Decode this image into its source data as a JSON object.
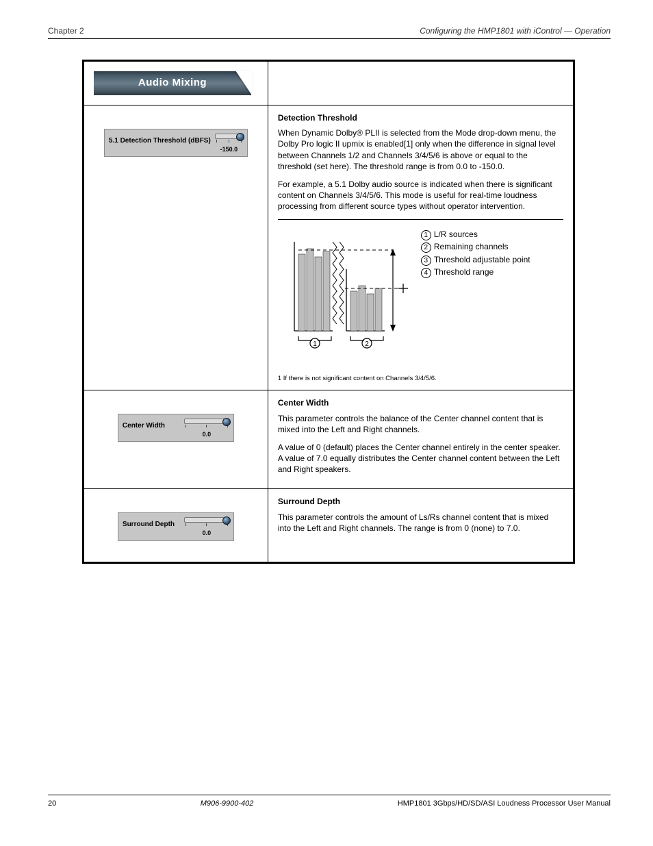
{
  "header": {
    "left": "Chapter 2",
    "right": "Configuring the HMP1801 with iControl — Operation"
  },
  "banner": {
    "title": "Audio Mixing"
  },
  "rows": [
    {
      "widget": {
        "label": "5.1 Detection Threshold (dBFS)",
        "value": "-150.0"
      },
      "desc": {
        "title": "Detection Threshold",
        "paragraphs": [
          "When Dynamic Dolby® PLII is selected from the Mode drop-down menu, the Dolby Pro logic II upmix is enabled[1] only when the difference in signal level between Channels 1/2 and Channels 3/4/5/6 is above or equal to the threshold (set here). The threshold range is from 0.0 to -150.0.",
          "For example, a 5.1 Dolby audio source is indicated when there is significant content on Channels 3/4/5/6. This mode is useful for real-time loudness processing from different source types without operator intervention."
        ],
        "chart": {
          "legend": [
            {
              "n": 1,
              "text": "L/R sources"
            },
            {
              "n": 2,
              "text": "Remaining channels"
            },
            {
              "n": 3,
              "text": "Threshold adjustable point"
            },
            {
              "n": 4,
              "text": "Threshold range"
            }
          ]
        },
        "footnote": "1 If there is not significant content on Channels 3/4/5/6."
      }
    },
    {
      "widget": {
        "label": "Center Width",
        "value": "0.0"
      },
      "desc": {
        "title": "Center Width",
        "paragraphs": [
          "This parameter controls the balance of the Center channel content that is mixed into the Left and Right channels.",
          "A value of 0 (default) places the Center channel entirely in the center speaker. A value of 7.0 equally distributes the Center channel content between the Left and Right speakers."
        ]
      }
    },
    {
      "widget": {
        "label": "Surround Depth",
        "value": "0.0"
      },
      "desc": {
        "title": "Surround Depth",
        "paragraphs": [
          "This parameter controls the amount of Ls/Rs channel content that is mixed into the Left and Right channels. The range is from 0 (none) to 7.0."
        ]
      }
    }
  ],
  "footer": {
    "left": "20",
    "mid": "M906-9900-402",
    "right": "HMP1801 3Gbps/HD/SD/ASI Loudness Processor User Manual"
  }
}
